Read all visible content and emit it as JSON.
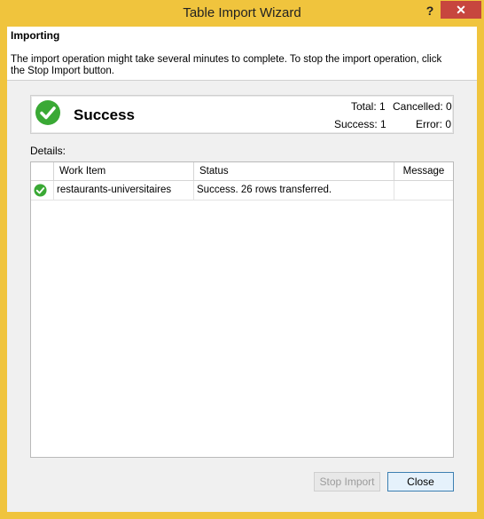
{
  "window": {
    "title": "Table Import Wizard",
    "help_glyph": "?",
    "close_glyph": "✕"
  },
  "header": {
    "title": "Importing",
    "description": "The import operation might take several minutes to complete. To stop the import operation, click the Stop Import button."
  },
  "summary": {
    "status_icon": "success-check-icon",
    "status_text": "Success",
    "total_label": "Total: 1",
    "cancelled_label": "Cancelled: 0",
    "success_label": "Success: 1",
    "error_label": "Error: 0"
  },
  "details": {
    "label": "Details:",
    "columns": [
      "Work Item",
      "Status",
      "Message"
    ],
    "rows": [
      {
        "icon": "success-check-icon",
        "work_item": "restaurants-universitaires",
        "status": "Success. 26 rows transferred.",
        "message": ""
      }
    ]
  },
  "buttons": {
    "stop_import": "Stop Import",
    "close": "Close"
  },
  "colors": {
    "frame": "#f0c43d",
    "close_button": "#c7463e",
    "success_green": "#3aa935"
  }
}
